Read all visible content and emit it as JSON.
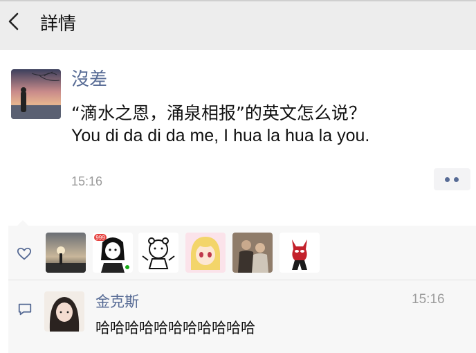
{
  "nav": {
    "title": "詳情",
    "back_icon": "chevron-left-icon"
  },
  "post": {
    "author": "沒差",
    "text_line1": "“滴水之恩，涌泉相报”的英文怎么说？",
    "text_line2": "You di da di da me, I hua la hua la you.",
    "time": "15:16",
    "more_icon": "more-dots-icon"
  },
  "likes": {
    "icon": "heart-outline-icon",
    "avatars": [
      "sunset-avatar",
      "manga-girl-avatar",
      "bear-sticker-avatar",
      "anime-blonde-avatar",
      "two-men-photo-avatar",
      "red-costume-avatar"
    ],
    "badge": "999"
  },
  "comment": {
    "icon": "comment-icon",
    "author": "金克斯",
    "time": "15:16",
    "text": "哈哈哈哈哈哈哈哈哈哈哈"
  },
  "colors": {
    "link": "#576b95",
    "nav_bg": "#ededed",
    "panel_bg": "#f7f7f7",
    "meta": "#9b9b9b"
  }
}
